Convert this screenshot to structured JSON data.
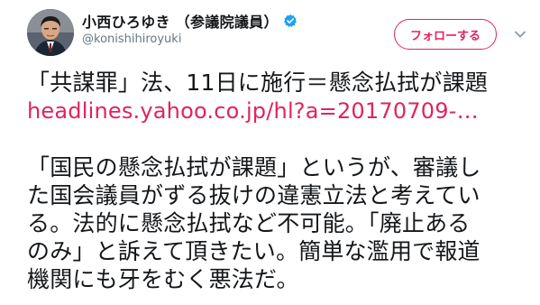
{
  "tweet": {
    "display_name": "小西ひろゆき （参議院議員）",
    "handle": "@konishihiroyuki",
    "follow_label": "フォローする",
    "lines_1": [
      "「共謀罪」法、11日に施行＝懸念払拭が課題"
    ],
    "link": "headlines.yahoo.co.jp/hl?a=20170709-…",
    "lines_2": [
      "「国民の懸念払拭が課題」というが、審議し",
      "た国会議員がずる抜けの違憲立法と考えてい",
      "る。法的に懸念払拭など不可能。「廃止ある",
      "のみ」と訴えて頂きたい。簡単な濫用で報道",
      "機関にも牙をむく悪法だ。"
    ]
  },
  "icons": {
    "verified": "verified-badge-icon",
    "caret": "chevron-down-icon"
  },
  "colors": {
    "accent": "#e0245e",
    "verified": "#1da1f2",
    "text": "#14171a",
    "muted": "#657786"
  }
}
